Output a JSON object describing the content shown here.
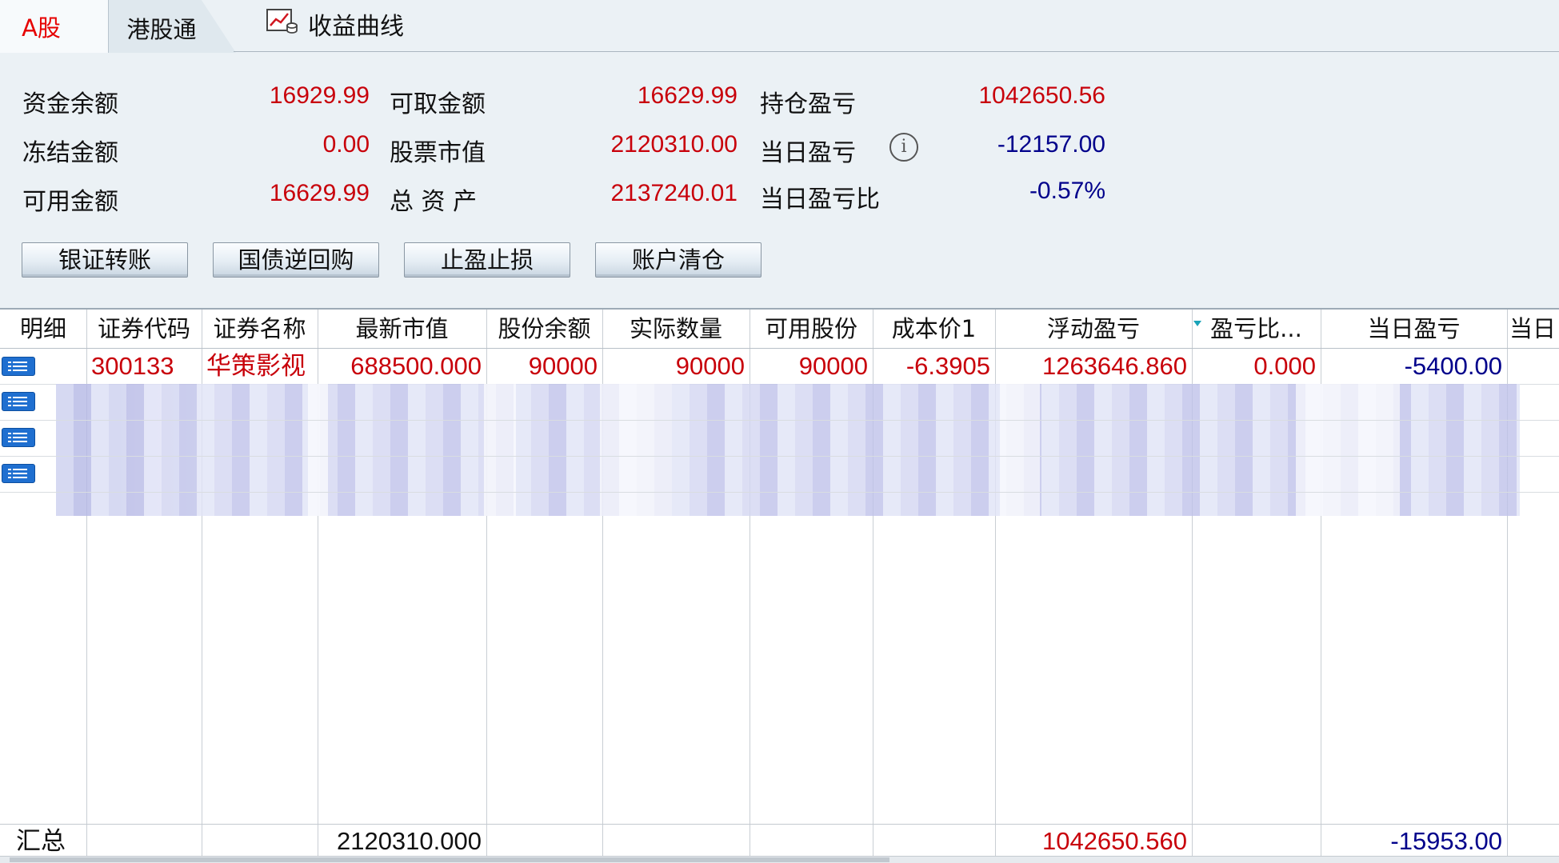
{
  "tabs": {
    "a_share": "A股",
    "hk_connect": "港股通",
    "curve": "收益曲线"
  },
  "summary": {
    "fund_balance_label": "资金余额",
    "fund_balance": "16929.99",
    "frozen_label": "冻结金额",
    "frozen": "0.00",
    "available_label": "可用金额",
    "available": "16629.99",
    "withdrawable_label": "可取金额",
    "withdrawable": "16629.99",
    "market_value_label": "股票市值",
    "market_value": "2120310.00",
    "total_assets_label": "总 资 产",
    "total_assets": "2137240.01",
    "position_pl_label": "持仓盈亏",
    "position_pl": "1042650.56",
    "daily_pl_label": "当日盈亏",
    "daily_pl": "-12157.00",
    "daily_pl_ratio_label": "当日盈亏比",
    "daily_pl_ratio": "-0.57%",
    "info_glyph": "i"
  },
  "buttons": {
    "bank_transfer": "银证转账",
    "repo": "国债逆回购",
    "stop": "止盈止损",
    "clear": "账户清仓"
  },
  "table": {
    "headers": [
      "明细",
      "证券代码",
      "证券名称",
      "最新市值",
      "股份余额",
      "实际数量",
      "可用股份",
      "成本价1",
      "浮动盈亏",
      "盈亏比...",
      "当日盈亏",
      "当日"
    ],
    "rows": [
      {
        "code": "300133",
        "name": "华策影视",
        "market_value": "688500.000",
        "balance": "90000",
        "actual": "90000",
        "available": "90000",
        "cost": "-6.3905",
        "float_pl": "1263646.860",
        "pl_ratio": "0.000",
        "daily_pl": "-5400.00"
      }
    ],
    "total": {
      "label": "汇总",
      "market_value": "2120310.000",
      "float_pl": "1042650.560",
      "daily_pl": "-15953.00"
    }
  },
  "colors": {
    "positive": "#c8000a",
    "negative": "#00008b",
    "panel": "#ebf1f5",
    "tab_active_text": "#e60000"
  }
}
